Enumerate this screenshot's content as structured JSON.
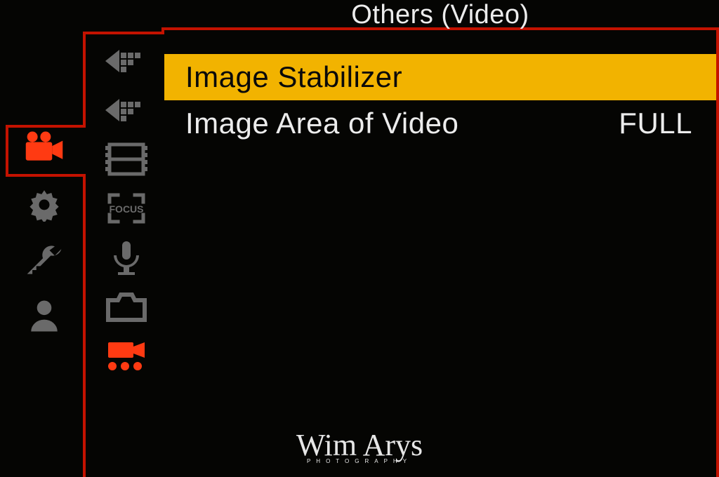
{
  "title": "Others (Video)",
  "categories": [
    {
      "id": "video",
      "active": true
    },
    {
      "id": "gear",
      "active": false
    },
    {
      "id": "wrench",
      "active": false
    },
    {
      "id": "person",
      "active": false
    }
  ],
  "sub_tabs": [
    {
      "id": "quality1",
      "active": false
    },
    {
      "id": "quality2",
      "active": false
    },
    {
      "id": "film",
      "active": false
    },
    {
      "id": "focus",
      "active": false
    },
    {
      "id": "mic",
      "active": false
    },
    {
      "id": "monitor",
      "active": false
    },
    {
      "id": "others",
      "active": true
    }
  ],
  "menu": {
    "items": [
      {
        "label": "Image Stabilizer",
        "value": "",
        "selected": true
      },
      {
        "label": "Image Area of Video",
        "value": "FULL",
        "selected": false
      }
    ]
  },
  "watermark": {
    "signature": "Wim Arys",
    "subtitle": "PHOTOGRAPHY"
  },
  "colors": {
    "accent": "#c41200",
    "highlight": "#f2b300",
    "inactive": "#6a6a6a",
    "active_icon": "#ff3a12"
  }
}
